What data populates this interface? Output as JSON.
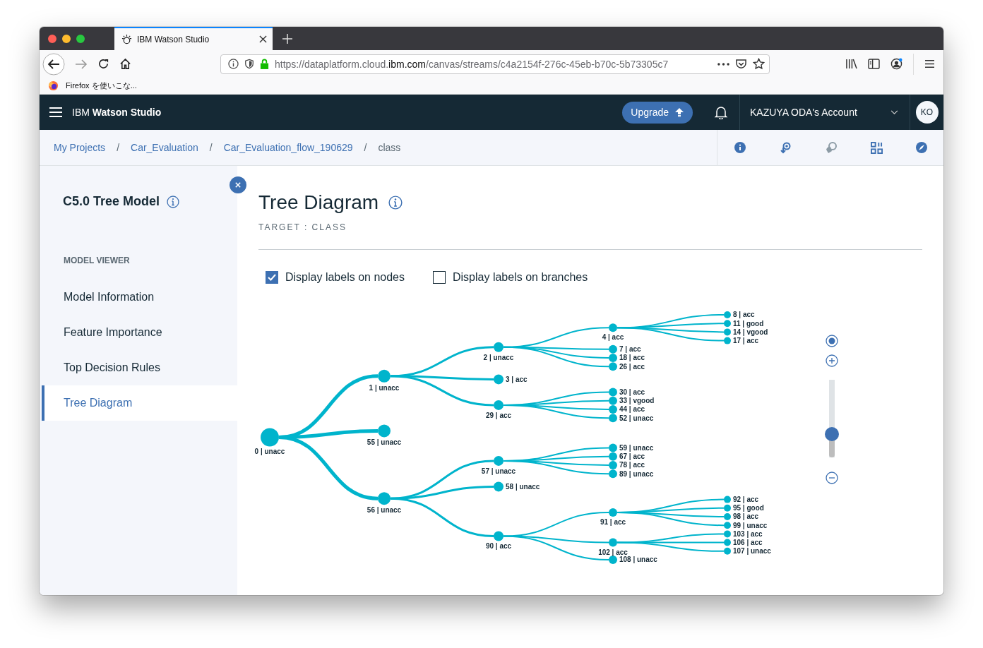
{
  "browser": {
    "tab": {
      "title": "IBM Watson Studio"
    },
    "url": {
      "prefix": "https://dataplatform.cloud.",
      "domain": "ibm.com",
      "path": "/canvas/streams/c4a2154f-276c-45eb-b70c-5b73305c7"
    },
    "bookmarks": [
      {
        "label": "Firefox を使いこな..."
      }
    ]
  },
  "header": {
    "app_name": "IBM **Watson Studio**",
    "upgrade": "Upgrade",
    "account": "KAZUYA ODA's Account",
    "avatar": "KO"
  },
  "breadcrumbs": {
    "separator": "/",
    "items": [
      {
        "label": "My Projects",
        "link": true
      },
      {
        "label": "Car_Evaluation",
        "link": true
      },
      {
        "label": "Car_Evaluation_flow_190629",
        "link": true
      },
      {
        "label": "class",
        "link": false
      }
    ]
  },
  "sidebar": {
    "title": "C5.0 Tree Model",
    "section": "MODEL VIEWER",
    "items": [
      {
        "label": "Model Information",
        "selected": false
      },
      {
        "label": "Feature Importance",
        "selected": false
      },
      {
        "label": "Top Decision Rules",
        "selected": false
      },
      {
        "label": "Tree Diagram",
        "selected": true
      }
    ]
  },
  "main": {
    "title": "Tree Diagram",
    "subtitle": "TARGET : CLASS",
    "options": [
      {
        "label": "Display labels on nodes",
        "checked": true
      },
      {
        "label": "Display labels on branches",
        "checked": false
      }
    ],
    "tree": {
      "label": "0 | unacc",
      "children": [
        {
          "label": "1 | unacc",
          "children": [
            {
              "label": "2 | unacc",
              "children": [
                {
                  "label": "4 | acc",
                  "children": [
                    {
                      "label": "8 | acc"
                    },
                    {
                      "label": "11 | good"
                    },
                    {
                      "label": "14 | vgood"
                    },
                    {
                      "label": "17 | acc"
                    }
                  ]
                },
                {
                  "label": "7 | acc"
                },
                {
                  "label": "18 | acc"
                },
                {
                  "label": "26 | acc"
                }
              ]
            },
            {
              "label": "3 | acc"
            },
            {
              "label": "29 | acc",
              "children": [
                {
                  "label": "30 | acc"
                },
                {
                  "label": "33 | vgood"
                },
                {
                  "label": "44 | acc"
                },
                {
                  "label": "52 | unacc"
                }
              ]
            }
          ]
        },
        {
          "label": "55 | unacc"
        },
        {
          "label": "56 | unacc",
          "children": [
            {
              "label": "57 | unacc",
              "children": [
                {
                  "label": "59 | unacc"
                },
                {
                  "label": "67 | acc"
                },
                {
                  "label": "78 | acc"
                },
                {
                  "label": "89 | unacc"
                }
              ]
            },
            {
              "label": "58 | unacc"
            },
            {
              "label": "90 | acc",
              "children": [
                {
                  "label": "91 | acc",
                  "children": [
                    {
                      "label": "92 | acc"
                    },
                    {
                      "label": "95 | good"
                    },
                    {
                      "label": "98 | acc"
                    },
                    {
                      "label": "99 | unacc"
                    }
                  ]
                },
                {
                  "label": "102 | acc",
                  "children": [
                    {
                      "label": "103 | acc"
                    },
                    {
                      "label": "106 | acc"
                    },
                    {
                      "label": "107 | unacc"
                    }
                  ]
                },
                {
                  "label": "108 | unacc"
                }
              ]
            }
          ]
        }
      ]
    },
    "zoom": {
      "level": 0.3
    }
  }
}
